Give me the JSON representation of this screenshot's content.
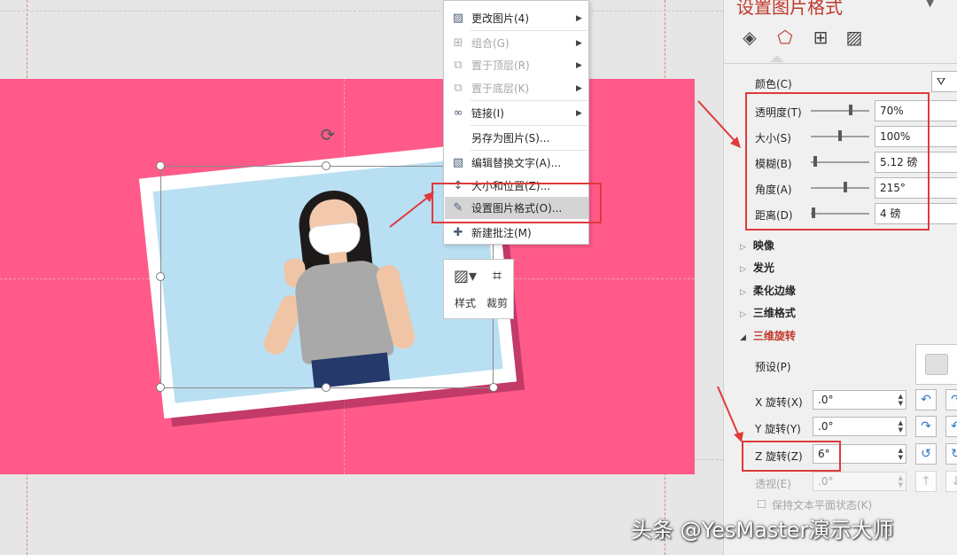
{
  "context_menu": {
    "items": [
      {
        "label": "更改图片(4)",
        "icon": "change-picture-icon",
        "submenu": true,
        "enabled": true
      },
      {
        "label": "组合(G)",
        "icon": "group-icon",
        "submenu": true,
        "enabled": false
      },
      {
        "label": "置于顶层(R)",
        "icon": "bring-to-front-icon",
        "submenu": true,
        "enabled": false
      },
      {
        "label": "置于底层(K)",
        "icon": "send-to-back-icon",
        "submenu": true,
        "enabled": false
      },
      {
        "label": "链接(I)",
        "icon": "link-icon",
        "submenu": true,
        "enabled": true
      },
      {
        "label": "另存为图片(S)...",
        "icon": "",
        "submenu": false,
        "enabled": true
      },
      {
        "label": "编辑替换文字(A)...",
        "icon": "alt-text-icon",
        "submenu": false,
        "enabled": true
      },
      {
        "label": "大小和位置(Z)...",
        "icon": "size-position-icon",
        "submenu": false,
        "enabled": true
      },
      {
        "label": "设置图片格式(O)...",
        "icon": "format-picture-icon",
        "submenu": false,
        "enabled": true,
        "highlighted": true
      },
      {
        "label": "新建批注(M)",
        "icon": "new-comment-icon",
        "submenu": false,
        "enabled": true
      }
    ]
  },
  "mini_toolbar": {
    "style_label": "样式",
    "crop_label": "裁剪"
  },
  "format_pane": {
    "title": "设置图片格式",
    "color_label": "颜色(C)",
    "shadow": {
      "transparency_label": "透明度(T)",
      "transparency_value": "70%",
      "transparency_level": 0.7,
      "size_label": "大小(S)",
      "size_value": "100%",
      "size_level": 0.5,
      "blur_label": "模糊(B)",
      "blur_value": "5.12 磅",
      "blur_level": 0.05,
      "angle_label": "角度(A)",
      "angle_value": "215°",
      "angle_level": 0.6,
      "distance_label": "距离(D)",
      "distance_value": "4 磅",
      "distance_level": 0.02
    },
    "sections": [
      {
        "label": "映像",
        "expanded": false
      },
      {
        "label": "发光",
        "expanded": false
      },
      {
        "label": "柔化边缘",
        "expanded": false
      },
      {
        "label": "三维格式",
        "expanded": false
      },
      {
        "label": "三维旋转",
        "expanded": true
      }
    ],
    "rotation_3d": {
      "preset_label": "预设(P)",
      "x_label": "X 旋转(X)",
      "x_value": ".0°",
      "y_label": "Y 旋转(Y)",
      "y_value": ".0°",
      "z_label": "Z 旋转(Z)",
      "z_value": "6°",
      "perspective_label": "透视(E)",
      "perspective_value": ".0°",
      "keep_text_flat_label": "保持文本平面状态(K)"
    }
  },
  "watermark": "头条 @YesMaster演示大师",
  "colors": {
    "slide_bg": "#ff5a8a",
    "accent_red": "#e03a3a",
    "title_red": "#c0392b"
  }
}
